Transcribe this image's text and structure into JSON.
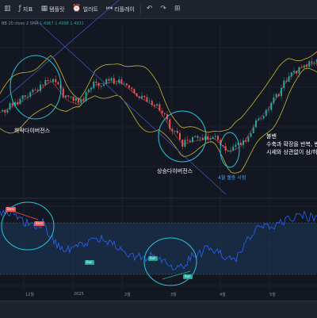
{
  "toolbar": {
    "items": [
      {
        "icon": "chart-type-icon",
        "glyph": "▥",
        "label": ""
      },
      {
        "icon": "indicators-icon",
        "glyph": "ƒ",
        "label": "지표"
      },
      {
        "icon": "templates-icon",
        "glyph": "▦",
        "label": "탬플릿"
      },
      {
        "icon": "alert-icon",
        "glyph": "⏰",
        "label": "얼러트"
      },
      {
        "icon": "replay-icon",
        "glyph": "⏮",
        "label": "리플레이"
      },
      {
        "icon": "undo-icon",
        "glyph": "↶",
        "label": ""
      },
      {
        "icon": "redo-icon",
        "glyph": "↷",
        "label": ""
      },
      {
        "icon": "drawing-tools-icon",
        "glyph": "⊞",
        "label": ""
      }
    ]
  },
  "legend": {
    "text": "BB 20 close 2 SMA",
    "values": "1.4967  1.4998  1.4931"
  },
  "annotations": {
    "bearish_divergence": "하락다이버전스",
    "bullish_divergence": "상승다이버전스",
    "low_label": "4월 쉘충 시점",
    "note_lines": [
      "볼밴",
      "수축과 확장을 반복, 변",
      "시세와 상관없이 삼/하"
    ]
  },
  "signals": {
    "bear": "Bear",
    "bull": "Bull"
  },
  "time_axis": [
    "12월",
    "2025",
    "2월",
    "3월",
    "4월",
    "5월"
  ],
  "colors": {
    "background": "#131722",
    "candle_up": "#26a69a",
    "candle_down": "#ef5350",
    "bollinger": "#c7b630",
    "rsi_line": "#2962ff",
    "rsi_band": "#1c3a5c",
    "trendline": "#3f51b5",
    "circle": "#26c6da"
  }
}
